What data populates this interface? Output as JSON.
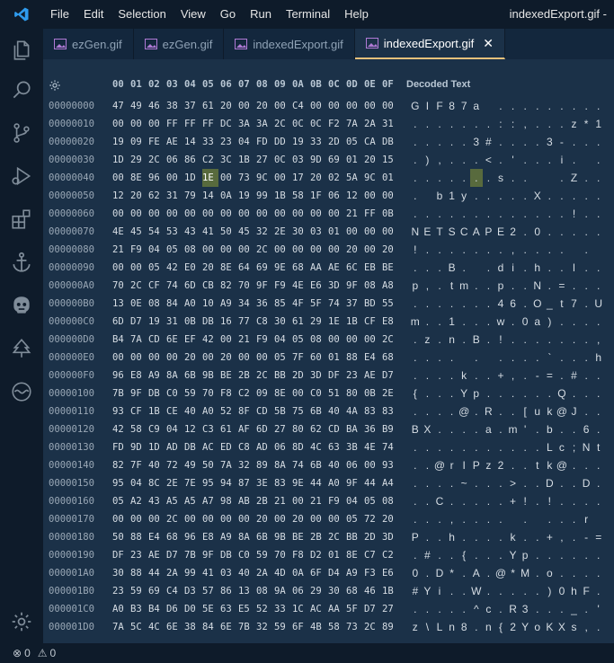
{
  "title_bar": {
    "menu": [
      "File",
      "Edit",
      "Selection",
      "View",
      "Go",
      "Run",
      "Terminal",
      "Help"
    ],
    "window_title": "indexedExport.gif -"
  },
  "activity_bar": [
    "explorer-icon",
    "search-icon",
    "source-control-icon",
    "run-debug-icon",
    "extensions-icon",
    "anchor-icon",
    "robot-icon",
    "tree-icon",
    "wave-icon",
    "settings-gear-icon"
  ],
  "tabs": [
    {
      "label": "ezGen.gif",
      "active": false
    },
    {
      "label": "ezGen.gif",
      "active": false
    },
    {
      "label": "indexedExport.gif",
      "active": false
    },
    {
      "label": "indexedExport.gif",
      "active": true,
      "close": "✕"
    }
  ],
  "hex": {
    "header_bytes": [
      "00",
      "01",
      "02",
      "03",
      "04",
      "05",
      "06",
      "07",
      "08",
      "09",
      "0A",
      "0B",
      "0C",
      "0D",
      "0E",
      "0F"
    ],
    "decoded_header": "Decoded Text",
    "selected": {
      "row": 4,
      "col": 5
    },
    "rows": [
      {
        "offset": "00000000",
        "bytes": [
          "47",
          "49",
          "46",
          "38",
          "37",
          "61",
          "20",
          "00",
          "20",
          "00",
          "C4",
          "00",
          "00",
          "00",
          "00",
          "00"
        ],
        "text": [
          "G",
          "I",
          "F",
          "8",
          "7",
          "a",
          " ",
          ".",
          ".",
          ".",
          ".",
          ".",
          ".",
          ".",
          ".",
          "."
        ]
      },
      {
        "offset": "00000010",
        "bytes": [
          "00",
          "00",
          "00",
          "FF",
          "FF",
          "FF",
          "DC",
          "3A",
          "3A",
          "2C",
          "0C",
          "0C",
          "F2",
          "7A",
          "2A",
          "31"
        ],
        "text": [
          ".",
          ".",
          ".",
          ".",
          ".",
          ".",
          ".",
          ":",
          ":",
          ",",
          ".",
          ".",
          ".",
          "z",
          "*",
          "1"
        ]
      },
      {
        "offset": "00000020",
        "bytes": [
          "19",
          "09",
          "FE",
          "AE",
          "14",
          "33",
          "23",
          "04",
          "FD",
          "DD",
          "19",
          "33",
          "2D",
          "05",
          "CA",
          "DB"
        ],
        "text": [
          ".",
          ".",
          ".",
          ".",
          ".",
          "3",
          "#",
          ".",
          ".",
          ".",
          ".",
          "3",
          "-",
          ".",
          ".",
          "."
        ]
      },
      {
        "offset": "00000030",
        "bytes": [
          "1D",
          "29",
          "2C",
          "06",
          "86",
          "C2",
          "3C",
          "1B",
          "27",
          "0C",
          "03",
          "9D",
          "69",
          "01",
          "20",
          "15"
        ],
        "text": [
          ".",
          ")",
          ",",
          ".",
          ".",
          ".",
          "<",
          ".",
          "'",
          ".",
          ".",
          ".",
          "i",
          ".",
          " ",
          "."
        ]
      },
      {
        "offset": "00000040",
        "bytes": [
          "00",
          "8E",
          "96",
          "00",
          "1D",
          "1E",
          "00",
          "73",
          "9C",
          "00",
          "17",
          "20",
          "02",
          "5A",
          "9C",
          "01"
        ],
        "text": [
          ".",
          ".",
          ".",
          ".",
          ".",
          ".",
          ".",
          "s",
          ".",
          ".",
          " ",
          " ",
          ".",
          "Z",
          ".",
          "."
        ]
      },
      {
        "offset": "00000050",
        "bytes": [
          "12",
          "20",
          "62",
          "31",
          "79",
          "14",
          "0A",
          "19",
          "99",
          "1B",
          "58",
          "1F",
          "06",
          "12",
          "00",
          "00"
        ],
        "text": [
          ".",
          " ",
          "b",
          "1",
          "y",
          ".",
          ".",
          ".",
          ".",
          ".",
          "X",
          ".",
          ".",
          ".",
          ".",
          "."
        ]
      },
      {
        "offset": "00000060",
        "bytes": [
          "00",
          "00",
          "00",
          "00",
          "00",
          "00",
          "00",
          "00",
          "00",
          "00",
          "00",
          "00",
          "00",
          "21",
          "FF",
          "0B"
        ],
        "text": [
          ".",
          ".",
          ".",
          ".",
          ".",
          ".",
          ".",
          ".",
          ".",
          ".",
          ".",
          ".",
          ".",
          "!",
          ".",
          "."
        ]
      },
      {
        "offset": "00000070",
        "bytes": [
          "4E",
          "45",
          "54",
          "53",
          "43",
          "41",
          "50",
          "45",
          "32",
          "2E",
          "30",
          "03",
          "01",
          "00",
          "00",
          "00"
        ],
        "text": [
          "N",
          "E",
          "T",
          "S",
          "C",
          "A",
          "P",
          "E",
          "2",
          ".",
          "0",
          ".",
          ".",
          ".",
          ".",
          "."
        ]
      },
      {
        "offset": "00000080",
        "bytes": [
          "21",
          "F9",
          "04",
          "05",
          "08",
          "00",
          "00",
          "00",
          "2C",
          "00",
          "00",
          "00",
          "00",
          "20",
          "00",
          "20"
        ],
        "text": [
          "!",
          ".",
          ".",
          ".",
          ".",
          ".",
          ".",
          ".",
          ",",
          ".",
          ".",
          ".",
          ".",
          " ",
          ".",
          " "
        ]
      },
      {
        "offset": "00000090",
        "bytes": [
          "00",
          "00",
          "05",
          "42",
          "E0",
          "20",
          "8E",
          "64",
          "69",
          "9E",
          "68",
          "AA",
          "AE",
          "6C",
          "EB",
          "BE"
        ],
        "text": [
          ".",
          ".",
          ".",
          "B",
          ".",
          " ",
          ".",
          "d",
          "i",
          ".",
          "h",
          ".",
          ".",
          "l",
          ".",
          "."
        ]
      },
      {
        "offset": "000000A0",
        "bytes": [
          "70",
          "2C",
          "CF",
          "74",
          "6D",
          "CB",
          "82",
          "70",
          "9F",
          "F9",
          "4E",
          "E6",
          "3D",
          "9F",
          "08",
          "A8"
        ],
        "text": [
          "p",
          ",",
          ".",
          "t",
          "m",
          ".",
          ".",
          "p",
          ".",
          ".",
          "N",
          ".",
          "=",
          ".",
          ".",
          "."
        ]
      },
      {
        "offset": "000000B0",
        "bytes": [
          "13",
          "0E",
          "08",
          "84",
          "A0",
          "10",
          "A9",
          "34",
          "36",
          "85",
          "4F",
          "5F",
          "74",
          "37",
          "BD",
          "55"
        ],
        "text": [
          ".",
          ".",
          ".",
          ".",
          ".",
          ".",
          ".",
          "4",
          "6",
          ".",
          "O",
          "_",
          "t",
          "7",
          ".",
          "U"
        ]
      },
      {
        "offset": "000000C0",
        "bytes": [
          "6D",
          "D7",
          "19",
          "31",
          "0B",
          "DB",
          "16",
          "77",
          "C8",
          "30",
          "61",
          "29",
          "1E",
          "1B",
          "CF",
          "E8"
        ],
        "text": [
          "m",
          ".",
          ".",
          "1",
          ".",
          ".",
          ".",
          "w",
          ".",
          "0",
          "a",
          ")",
          ".",
          ".",
          ".",
          "."
        ]
      },
      {
        "offset": "000000D0",
        "bytes": [
          "B4",
          "7A",
          "CD",
          "6E",
          "EF",
          "42",
          "00",
          "21",
          "F9",
          "04",
          "05",
          "08",
          "00",
          "00",
          "00",
          "2C"
        ],
        "text": [
          ".",
          "z",
          ".",
          "n",
          ".",
          "B",
          ".",
          "!",
          ".",
          ".",
          ".",
          ".",
          ".",
          ".",
          ".",
          ","
        ]
      },
      {
        "offset": "000000E0",
        "bytes": [
          "00",
          "00",
          "00",
          "00",
          "20",
          "00",
          "20",
          "00",
          "00",
          "05",
          "7F",
          "60",
          "01",
          "88",
          "E4",
          "68"
        ],
        "text": [
          ".",
          ".",
          ".",
          ".",
          " ",
          ".",
          " ",
          ".",
          ".",
          ".",
          ".",
          "`",
          ".",
          ".",
          ".",
          "h"
        ]
      },
      {
        "offset": "000000F0",
        "bytes": [
          "96",
          "E8",
          "A9",
          "8A",
          "6B",
          "9B",
          "BE",
          "2B",
          "2C",
          "BB",
          "2D",
          "3D",
          "DF",
          "23",
          "AE",
          "D7"
        ],
        "text": [
          ".",
          ".",
          ".",
          ".",
          "k",
          ".",
          ".",
          "+",
          ",",
          ".",
          "-",
          "=",
          ".",
          "#",
          ".",
          "."
        ]
      },
      {
        "offset": "00000100",
        "bytes": [
          "7B",
          "9F",
          "DB",
          "C0",
          "59",
          "70",
          "F8",
          "C2",
          "09",
          "8E",
          "00",
          "C0",
          "51",
          "80",
          "0B",
          "2E"
        ],
        "text": [
          "{",
          ".",
          ".",
          ".",
          "Y",
          "p",
          ".",
          ".",
          ".",
          ".",
          ".",
          ".",
          "Q",
          ".",
          ".",
          "."
        ]
      },
      {
        "offset": "00000110",
        "bytes": [
          "93",
          "CF",
          "1B",
          "CE",
          "40",
          "A0",
          "52",
          "8F",
          "CD",
          "5B",
          "75",
          "6B",
          "40",
          "4A",
          "83",
          "83"
        ],
        "text": [
          ".",
          ".",
          ".",
          ".",
          "@",
          ".",
          "R",
          ".",
          ".",
          "[",
          "u",
          "k",
          "@",
          "J",
          ".",
          "."
        ]
      },
      {
        "offset": "00000120",
        "bytes": [
          "42",
          "58",
          "C9",
          "04",
          "12",
          "C3",
          "61",
          "AF",
          "6D",
          "27",
          "80",
          "62",
          "CD",
          "BA",
          "36",
          "B9"
        ],
        "text": [
          "B",
          "X",
          ".",
          ".",
          ".",
          ".",
          "a",
          ".",
          "m",
          "'",
          ".",
          "b",
          ".",
          ".",
          "6",
          "."
        ]
      },
      {
        "offset": "00000130",
        "bytes": [
          "FD",
          "9D",
          "1D",
          "AD",
          "DB",
          "AC",
          "ED",
          "C8",
          "AD",
          "06",
          "8D",
          "4C",
          "63",
          "3B",
          "4E",
          "74"
        ],
        "text": [
          ".",
          ".",
          ".",
          ".",
          ".",
          ".",
          ".",
          ".",
          ".",
          ".",
          ".",
          "L",
          "c",
          ";",
          "N",
          "t"
        ]
      },
      {
        "offset": "00000140",
        "bytes": [
          "82",
          "7F",
          "40",
          "72",
          "49",
          "50",
          "7A",
          "32",
          "89",
          "8A",
          "74",
          "6B",
          "40",
          "06",
          "00",
          "93"
        ],
        "text": [
          ".",
          ".",
          "@",
          "r",
          "I",
          "P",
          "z",
          "2",
          ".",
          ".",
          "t",
          "k",
          "@",
          ".",
          ".",
          "."
        ]
      },
      {
        "offset": "00000150",
        "bytes": [
          "95",
          "04",
          "8C",
          "2E",
          "7E",
          "95",
          "94",
          "87",
          "3E",
          "83",
          "9E",
          "44",
          "A0",
          "9F",
          "44",
          "A4"
        ],
        "text": [
          ".",
          ".",
          ".",
          ".",
          "~",
          ".",
          ".",
          ".",
          ">",
          ".",
          ".",
          "D",
          ".",
          ".",
          "D",
          "."
        ]
      },
      {
        "offset": "00000160",
        "bytes": [
          "05",
          "A2",
          "43",
          "A5",
          "A5",
          "A7",
          "98",
          "AB",
          "2B",
          "21",
          "00",
          "21",
          "F9",
          "04",
          "05",
          "08"
        ],
        "text": [
          ".",
          ".",
          "C",
          ".",
          ".",
          ".",
          ".",
          ".",
          "+",
          "!",
          ".",
          "!",
          ".",
          ".",
          ".",
          "."
        ]
      },
      {
        "offset": "00000170",
        "bytes": [
          "00",
          "00",
          "00",
          "2C",
          "00",
          "00",
          "00",
          "00",
          "20",
          "00",
          "20",
          "00",
          "00",
          "05",
          "72",
          "20"
        ],
        "text": [
          ".",
          ".",
          ".",
          ",",
          ".",
          ".",
          ".",
          ".",
          " ",
          ".",
          " ",
          ".",
          ".",
          ".",
          "r",
          " "
        ]
      },
      {
        "offset": "00000180",
        "bytes": [
          "50",
          "88",
          "E4",
          "68",
          "96",
          "E8",
          "A9",
          "8A",
          "6B",
          "9B",
          "BE",
          "2B",
          "2C",
          "BB",
          "2D",
          "3D"
        ],
        "text": [
          "P",
          ".",
          ".",
          "h",
          ".",
          ".",
          ".",
          ".",
          "k",
          ".",
          ".",
          "+",
          ",",
          ".",
          "-",
          "="
        ]
      },
      {
        "offset": "00000190",
        "bytes": [
          "DF",
          "23",
          "AE",
          "D7",
          "7B",
          "9F",
          "DB",
          "C0",
          "59",
          "70",
          "F8",
          "D2",
          "01",
          "8E",
          "C7",
          "C2"
        ],
        "text": [
          ".",
          "#",
          ".",
          ".",
          "{",
          ".",
          ".",
          ".",
          "Y",
          "p",
          ".",
          ".",
          ".",
          ".",
          ".",
          "."
        ]
      },
      {
        "offset": "000001A0",
        "bytes": [
          "30",
          "88",
          "44",
          "2A",
          "99",
          "41",
          "03",
          "40",
          "2A",
          "4D",
          "0A",
          "6F",
          "D4",
          "A9",
          "F3",
          "E6"
        ],
        "text": [
          "0",
          ".",
          "D",
          "*",
          ".",
          "A",
          ".",
          "@",
          "*",
          "M",
          ".",
          "o",
          ".",
          ".",
          ".",
          "."
        ]
      },
      {
        "offset": "000001B0",
        "bytes": [
          "23",
          "59",
          "69",
          "C4",
          "D3",
          "57",
          "86",
          "13",
          "08",
          "9A",
          "06",
          "29",
          "30",
          "68",
          "46",
          "1B"
        ],
        "text": [
          "#",
          "Y",
          "i",
          ".",
          ".",
          "W",
          ".",
          ".",
          ".",
          ".",
          ".",
          ")",
          "0",
          "h",
          "F",
          "."
        ]
      },
      {
        "offset": "000001C0",
        "bytes": [
          "A0",
          "B3",
          "B4",
          "D6",
          "D0",
          "5E",
          "63",
          "E5",
          "52",
          "33",
          "1C",
          "AC",
          "AA",
          "5F",
          "D7",
          "27"
        ],
        "text": [
          ".",
          ".",
          ".",
          ".",
          ".",
          "^",
          "c",
          ".",
          "R",
          "3",
          ".",
          ".",
          ".",
          "_",
          ".",
          "'"
        ]
      },
      {
        "offset": "000001D0",
        "bytes": [
          "7A",
          "5C",
          "4C",
          "6E",
          "38",
          "84",
          "6E",
          "7B",
          "32",
          "59",
          "6F",
          "4B",
          "58",
          "73",
          "2C",
          "89"
        ],
        "text": [
          "z",
          "\\",
          "L",
          "n",
          "8",
          ".",
          "n",
          "{",
          "2",
          "Y",
          "o",
          "K",
          "X",
          "s",
          ",",
          "."
        ]
      }
    ]
  },
  "status": {
    "errors": "0",
    "warnings": "0"
  },
  "colors": {
    "background": "#1b3148",
    "chrome": "#0e1b2a",
    "selection": "#586a3d",
    "active_tab_border": "#e5c07b",
    "vscode_blue": "#2f9bed"
  }
}
